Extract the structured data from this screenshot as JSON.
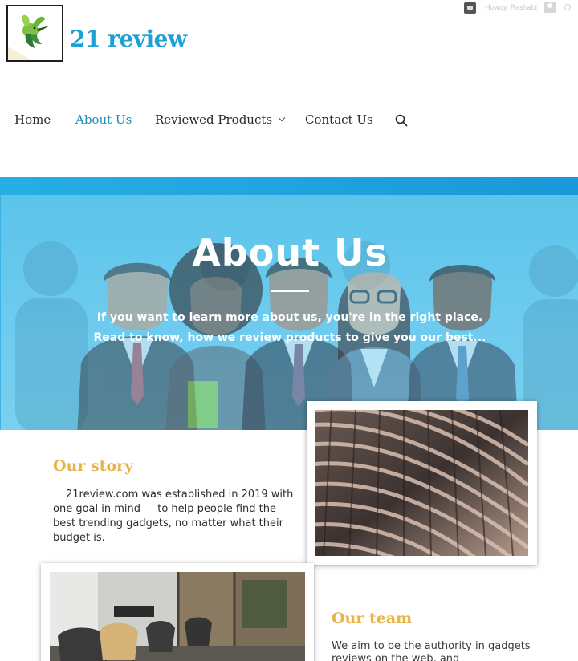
{
  "admin_bar": {
    "greeting": "Howdy, Rashabi",
    "icons": [
      "comment-icon",
      "avatar",
      "search-icon"
    ]
  },
  "site": {
    "title": "21 review",
    "logo_icon": "hummingbird-icon"
  },
  "nav": {
    "items": [
      {
        "label": "Home",
        "active": false
      },
      {
        "label": "About Us",
        "active": true
      },
      {
        "label": "Reviewed Products",
        "active": false,
        "has_dropdown": true
      },
      {
        "label": "Contact Us",
        "active": false
      }
    ],
    "search_icon": "search-icon"
  },
  "hero": {
    "title": "About Us",
    "subtitle_line1": "If you want to learn more about us, you're in the right place.",
    "subtitle_line2": "Read to know, how we review products to give you our best..."
  },
  "story": {
    "heading": "Our story",
    "text": "21review.com was established in 2019 with one goal in mind —  to help people find the best trending gadgets, no matter what their budget is."
  },
  "team": {
    "heading": "Our team",
    "text": "We aim to be the authority in gadgets reviews on the web, and"
  },
  "colors": {
    "accent": "#1da0d3",
    "nav_active": "#1b8fb6",
    "hero_bg": "#6dcbef",
    "section_heading": "#e8b44a"
  }
}
